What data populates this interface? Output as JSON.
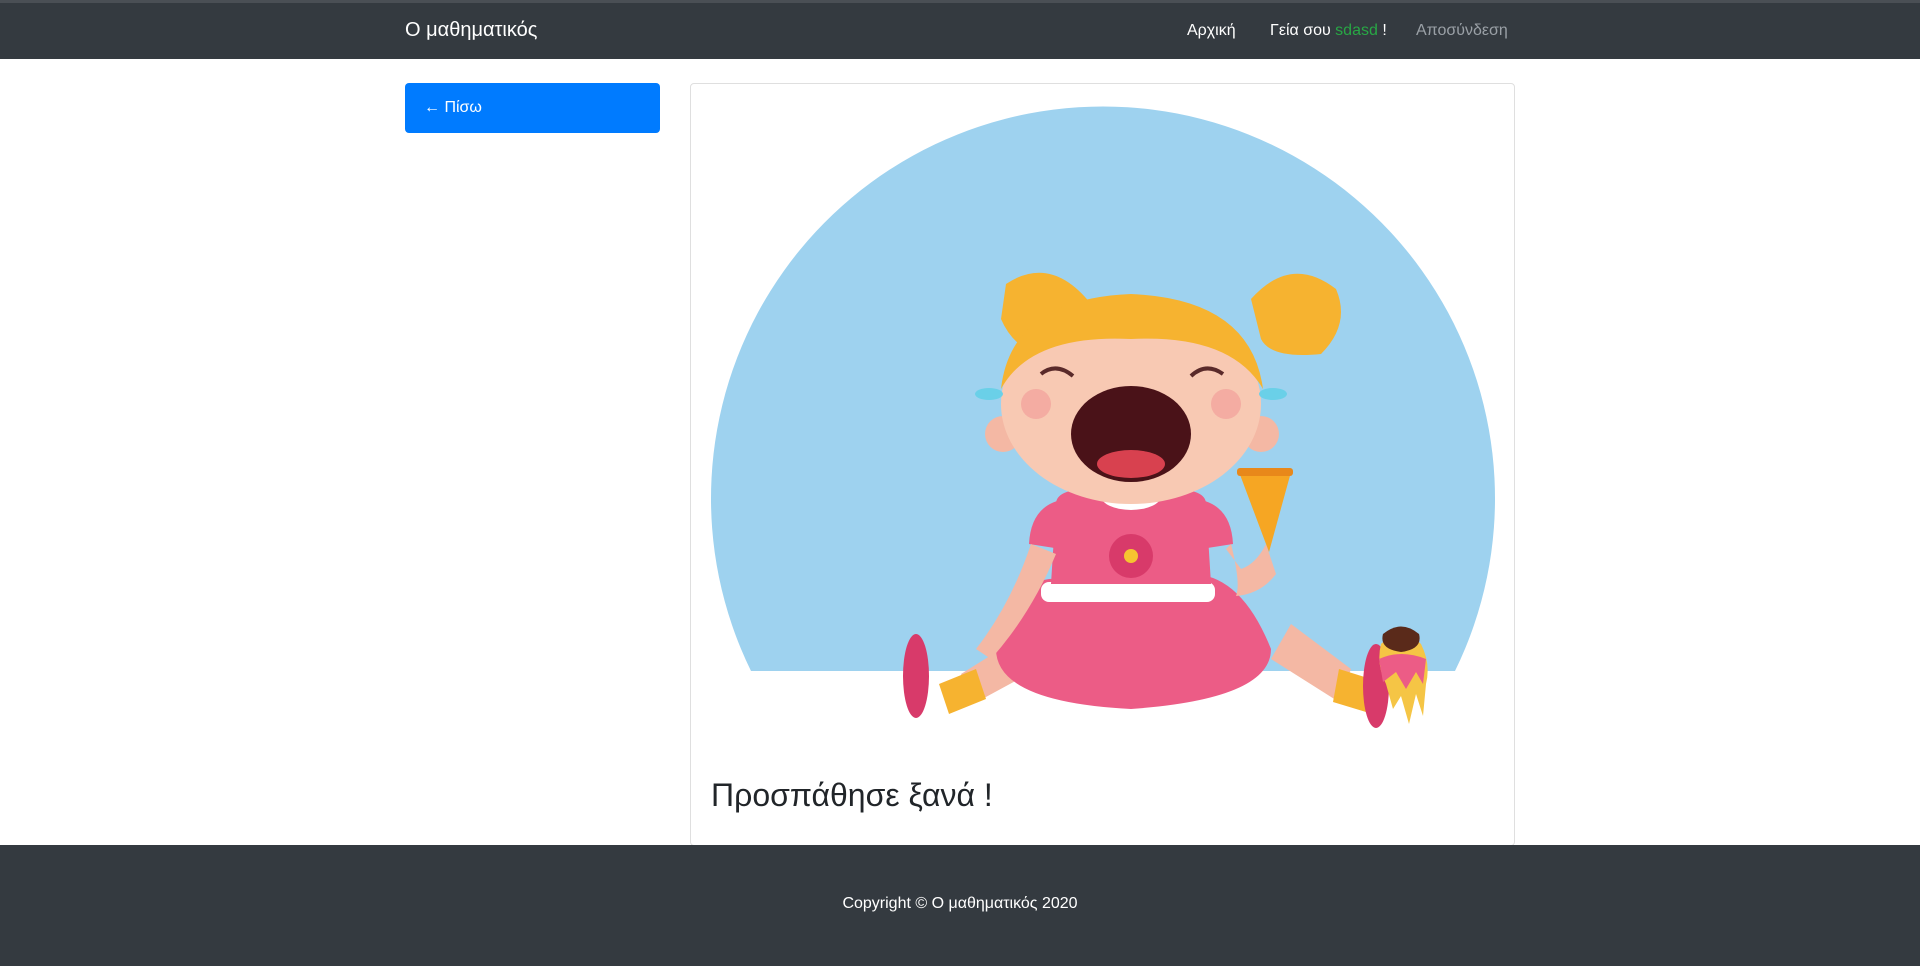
{
  "navbar": {
    "brand": "Ο μαθηματικός",
    "home": "Αρχική",
    "greeting_prefix": "Γεία σου",
    "username": "sdasd",
    "greeting_suffix": "!",
    "logout": "Αποσύνδεση"
  },
  "sidebar": {
    "back_button": "← Πίσω"
  },
  "card": {
    "title": "Προσπάθησε ξανά !",
    "illustration_icon": "crying-girl-with-dropped-ice-cream"
  },
  "footer": {
    "copyright": "Copyright © Ο μαθηματικός 2020"
  },
  "colors": {
    "navbar": "#343a40",
    "primary": "#007bff",
    "username": "#28a745",
    "circle": "#9ed2ef"
  }
}
